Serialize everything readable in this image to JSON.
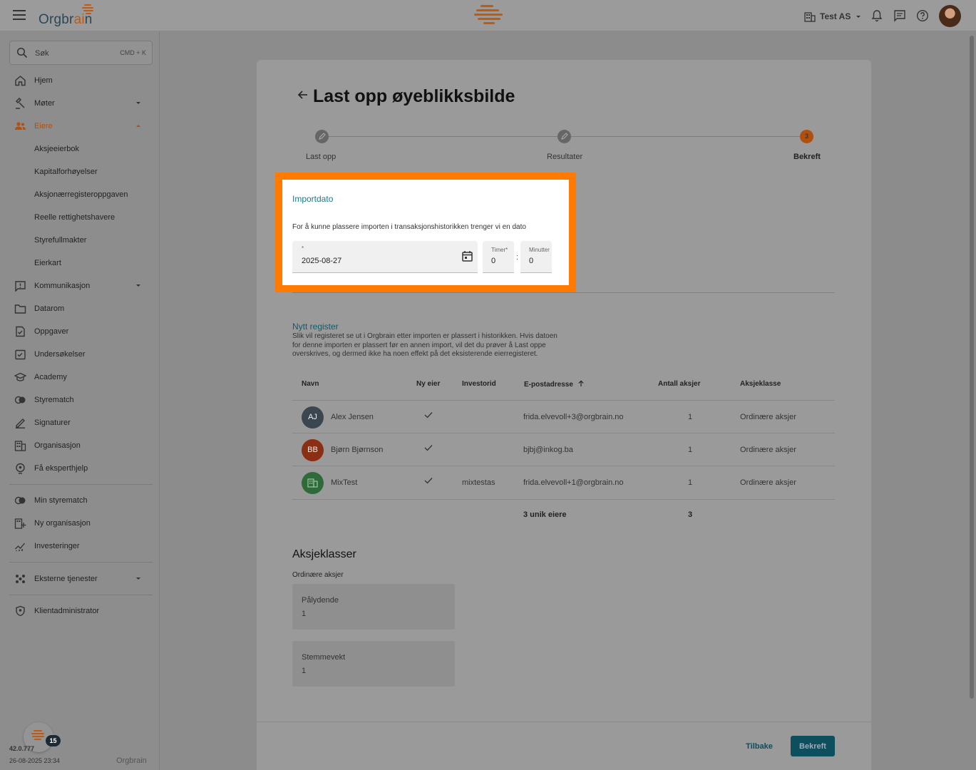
{
  "app": {
    "logo_text": "Orgbrain",
    "org_name": "Test AS"
  },
  "search": {
    "label": "Søk",
    "shortcut": "CMD + K"
  },
  "sidebar": {
    "items": [
      {
        "label": "Hjem"
      },
      {
        "label": "Møter"
      },
      {
        "label": "Eiere"
      },
      {
        "label": "Aksjeeierbok"
      },
      {
        "label": "Kapitalforhøyelser"
      },
      {
        "label": "Aksjonærregisteroppgaven"
      },
      {
        "label": "Reelle rettighetshavere"
      },
      {
        "label": "Styrefullmakter"
      },
      {
        "label": "Eierkart"
      },
      {
        "label": "Kommunikasjon"
      },
      {
        "label": "Datarom"
      },
      {
        "label": "Oppgaver"
      },
      {
        "label": "Undersøkelser"
      },
      {
        "label": "Academy"
      },
      {
        "label": "Styrematch"
      },
      {
        "label": "Signaturer"
      },
      {
        "label": "Organisasjon"
      },
      {
        "label": "Få eksperthjelp"
      },
      {
        "label": "Min styrematch"
      },
      {
        "label": "Ny organisasjon"
      },
      {
        "label": "Investeringer"
      },
      {
        "label": "Eksterne tjenester"
      },
      {
        "label": "Klientadministrator"
      }
    ],
    "notification_count": "15",
    "version": "42.0.777",
    "build_date": "26-08-2025 23:34",
    "brand": "Orgbrain"
  },
  "page": {
    "title": "Last opp øyeblikksbilde",
    "steps": [
      {
        "label": "Last opp"
      },
      {
        "label": "Resultater"
      },
      {
        "label": "Bekreft",
        "number": "3"
      }
    ],
    "import": {
      "title": "Importdato",
      "description": "For å kunne plassere importen i transaksjonshistorikken trenger vi en dato",
      "date_required_mark": "*",
      "date_value": "2025-08-27",
      "hours_label": "Timer*",
      "hours_value": "0",
      "minutes_label": "Minutter",
      "minutes_value": "0",
      "separator": ":"
    },
    "register": {
      "title": "Nytt register",
      "description": "Slik vil registeret se ut i Orgbrain etter importen er plassert i historikken. Hvis datoen for denne importen er plassert før en annen import, vil det du prøver å Last oppe overskrives, og dermed ikke ha noen effekt på det eksisterende eierregisteret."
    },
    "table": {
      "headers": {
        "name": "Navn",
        "new_owner": "Ny eier",
        "investor_id": "Investorid",
        "email": "E-postadresse",
        "shares": "Antall aksjer",
        "share_class": "Aksjeklasse"
      },
      "rows": [
        {
          "initials": "AJ",
          "name": "Alex Jensen",
          "investor_id": "",
          "email": "frida.elvevoll+3@orgbrain.no",
          "shares": "1",
          "share_class": "Ordinære aksjer",
          "color": "#3a4750"
        },
        {
          "initials": "BB",
          "name": "Bjørn Bjørnson",
          "investor_id": "",
          "email": "bjbj@inkog.ba",
          "shares": "1",
          "share_class": "Ordinære aksjer",
          "color": "#8a2e14"
        },
        {
          "initials": "",
          "name": "MixTest",
          "investor_id": "mixtestas",
          "email": "frida.elvevoll+1@orgbrain.no",
          "shares": "1",
          "share_class": "Ordinære aksjer",
          "color": "#2e6a3a"
        }
      ],
      "total_owners": "3 unik eiere",
      "total_shares": "3"
    },
    "share_classes": {
      "title": "Aksjeklasser",
      "class_name": "Ordinære aksjer",
      "par_label": "Pålydende",
      "par_value": "1",
      "vote_label": "Stemmevekt",
      "vote_value": "1"
    },
    "buttons": {
      "back": "Tilbake",
      "confirm": "Bekreft"
    }
  }
}
